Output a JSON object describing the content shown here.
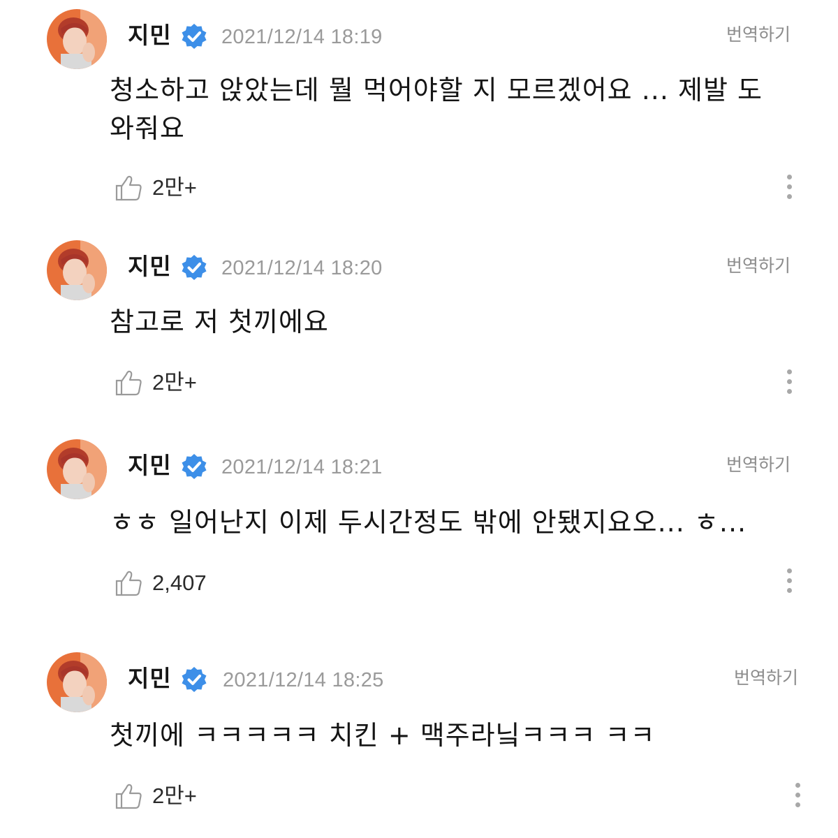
{
  "posts": [
    {
      "author": "지민",
      "timestamp": "2021/12/14 18:19",
      "translate_label": "번역하기",
      "message": "청소하고 앉았는데 뭘 먹어야할 지 모르겠어요 ... 제발 도와줘요",
      "likes": "2만+"
    },
    {
      "author": "지민",
      "timestamp": "2021/12/14 18:20",
      "translate_label": "번역하기",
      "message": "참고로 저 첫끼에요",
      "likes": "2만+"
    },
    {
      "author": "지민",
      "timestamp": "2021/12/14 18:21",
      "translate_label": "번역하기",
      "message": "ㅎㅎ 일어난지 이제 두시간정도 밖에 안됐지요오... ㅎ...",
      "likes": "2,407"
    },
    {
      "author": "지민",
      "timestamp": "2021/12/14 18:25",
      "translate_label": "번역하기",
      "message": "첫끼에 ㅋㅋㅋㅋㅋ 치킨 + 맥주라닠ㅋㅋㅋ ㅋㅋ",
      "likes": "2만+"
    }
  ],
  "colors": {
    "verified_badge": "#3d8fe8",
    "avatar_bg": "#e8713a",
    "timestamp_text": "#9a9a9a",
    "translate_text": "#8c8c8c"
  },
  "icons": {
    "verified": "verified-badge-icon",
    "like": "thumbs-up-icon",
    "more": "more-vertical-icon"
  }
}
